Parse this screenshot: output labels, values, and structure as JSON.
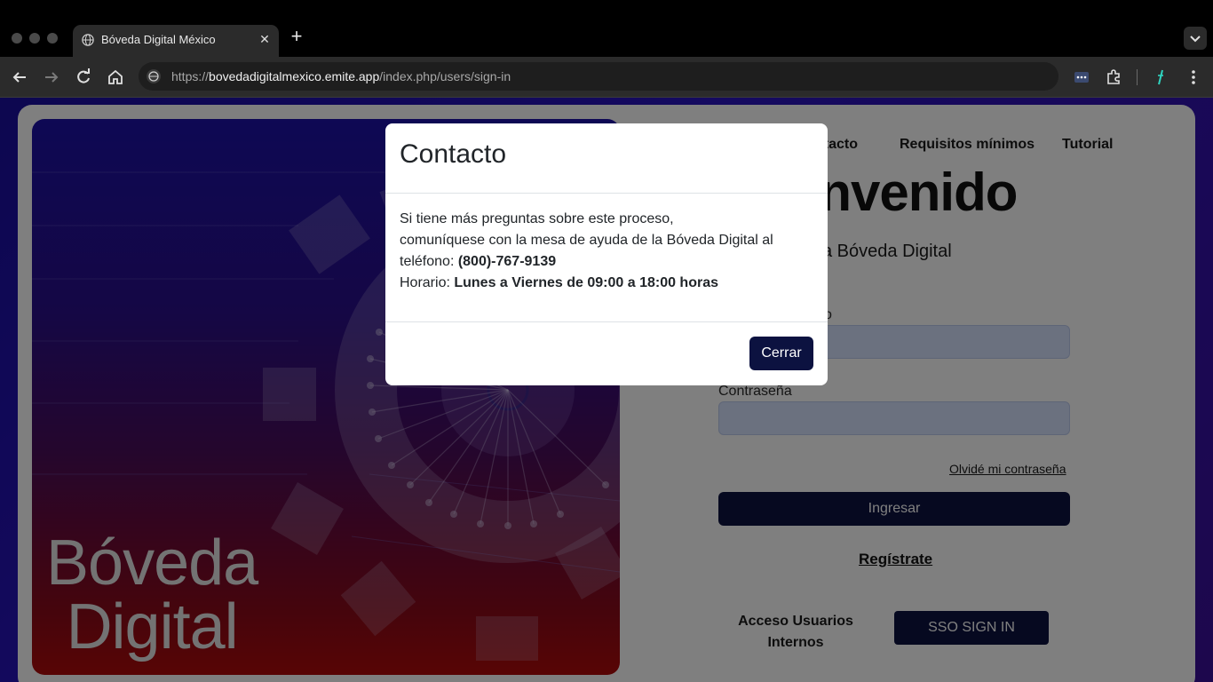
{
  "browser": {
    "tab_title": "Bóveda Digital México",
    "url_prefix": "https://",
    "url_host": "bovedadigitalmexico.emite.app",
    "url_path": "/index.php/users/sign-in"
  },
  "page": {
    "hero_line1": "Bóveda",
    "hero_line2": "Digital",
    "nav": {
      "contacto": "ntacto",
      "requisitos": "Requisitos mínimos",
      "tutorial": "Tutorial"
    },
    "welcome": "envenido",
    "subtitle": "a Bóveda Digital",
    "email_label": "co",
    "password_label": "Contraseña",
    "forgot_password": "Olvidé mi contraseña",
    "login_button": "Ingresar",
    "register_link": "Regístrate",
    "internal_access": "Acceso Usuarios Internos",
    "sso_button": "SSO SIGN IN"
  },
  "modal": {
    "title": "Contacto",
    "line1": "Si tiene más preguntas sobre este proceso,",
    "line2": "comuníquese con la mesa de ayuda de la Bóveda Digital al",
    "line3_prefix": "teléfono: ",
    "phone": "(800)-767-9139",
    "line4_prefix": "Horario: ",
    "hours": "Lunes a Viernes de 09:00 a 18:00 horas",
    "close_button": "Cerrar"
  },
  "colors": {
    "brand_dark": "#0c1240",
    "input_bg": "#d6e2ff",
    "backdrop": "rgba(0,0,0,0.5)"
  }
}
